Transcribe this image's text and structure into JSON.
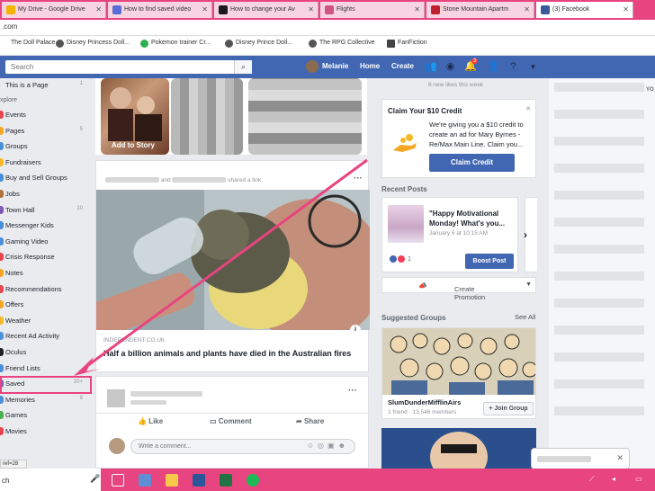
{
  "browser": {
    "tabs": [
      {
        "title": "My Drive - Google Drive",
        "color": "#f4b400"
      },
      {
        "title": "How to find saved video",
        "color": "#5b6cd8"
      },
      {
        "title": "How to change your Av",
        "color": "#1a1a1a"
      },
      {
        "title": "Flights",
        "color": "#d0557e"
      },
      {
        "title": "Stone Mountain Apartm",
        "color": "#c0202e"
      },
      {
        "title": "(3) Facebook",
        "color": "#3b5998"
      }
    ],
    "address": ".com",
    "bookmarks": [
      "The Doll Palace",
      "Disney Princess Doll...",
      "Pokemon trainer Cr...",
      "Disney Prince Doll...",
      "The RPG Collective",
      "FanFiction"
    ]
  },
  "fb_header": {
    "search_placeholder": "Search",
    "search_icon": "magnifier-icon",
    "user_name": "Melanie",
    "home_label": "Home",
    "create_label": "Create",
    "notification_count": "3",
    "brand_color": "#4267b2"
  },
  "left_nav": {
    "this_is_a_page": "This is a Page",
    "this_is_a_page_count": "1",
    "explore_heading": "xplore",
    "items": [
      {
        "label": "Events",
        "count": "",
        "color": "#e8464f"
      },
      {
        "label": "Pages",
        "count": "5",
        "color": "#f5a623"
      },
      {
        "label": "Groups",
        "count": "",
        "color": "#4a90d9"
      },
      {
        "label": "Fundraisers",
        "count": "",
        "color": "#f7b928"
      },
      {
        "label": "Buy and Sell Groups",
        "count": "",
        "color": "#4a90d9"
      },
      {
        "label": "Jobs",
        "count": "",
        "color": "#b0713a"
      },
      {
        "label": "Town Hall",
        "count": "10",
        "color": "#7d5ab5"
      },
      {
        "label": "Messenger Kids",
        "count": "",
        "color": "#4a90d9"
      },
      {
        "label": "Gaming Video",
        "count": "",
        "color": "#4a90d9"
      },
      {
        "label": "Crisis Response",
        "count": "",
        "color": "#e8464f"
      },
      {
        "label": "Notes",
        "count": "",
        "color": "#f5a623"
      },
      {
        "label": "Recommendations",
        "count": "",
        "color": "#e8464f"
      },
      {
        "label": "Offers",
        "count": "",
        "color": "#f5a623"
      },
      {
        "label": "Weather",
        "count": "",
        "color": "#f7b928"
      },
      {
        "label": "Recent Ad Activity",
        "count": "",
        "color": "#4a90d9"
      },
      {
        "label": "Oculus",
        "count": "",
        "color": "#1d2129"
      },
      {
        "label": "Friend Lists",
        "count": "",
        "color": "#4a90d9"
      },
      {
        "label": "Saved",
        "count": "20+",
        "color": "#7d5ab5"
      },
      {
        "label": "Memories",
        "count": "9",
        "color": "#4a90d9"
      },
      {
        "label": "Games",
        "count": "",
        "color": "#4caf50"
      },
      {
        "label": "Movies",
        "count": "",
        "color": "#e8464f"
      }
    ]
  },
  "stories": {
    "add_to_story": "Add to Story"
  },
  "post": {
    "shared_text": "and",
    "shared_suffix": "shared a link.",
    "source": "INDEPENDENT.CO.UK",
    "headline": "Half a billion animals and plants have died in the Australian fires"
  },
  "post2": {
    "like": "Like",
    "comment": "Comment",
    "share": "Share",
    "comment_placeholder": "Write a comment..."
  },
  "right_col": {
    "new_likes": "6 new likes this week",
    "credit_title": "Claim Your $10 Credit",
    "credit_body": "We're giving you a $10 credit to create an ad for Mary Byrnes - Re/Max Main Line. Claim you...",
    "credit_button": "Claim Credit",
    "recent_posts_heading": "Recent Posts",
    "recent_post_text": "\"Happy Motivational Monday! What's you...",
    "recent_post_date": "January 6 at 10:15 AM",
    "reaction_count": "1",
    "boost_button": "Boost Post",
    "create_promotion": "Create Promotion",
    "suggested_groups_heading": "Suggested Groups",
    "see_all": "See All",
    "group_name": "SlumDunderMifflinAirs",
    "group_members": "1 friend · 13,546 members",
    "join_button": "+ Join Group"
  },
  "chat": {
    "heading": "YO"
  },
  "taskbar": {
    "search_text": "ch",
    "status_url": "ref=28"
  }
}
